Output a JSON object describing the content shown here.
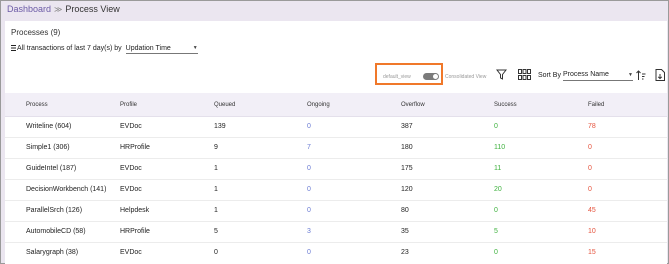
{
  "breadcrumb": {
    "root": "Dashboard",
    "separator": "≫",
    "current": "Process View"
  },
  "processes": {
    "heading": "Processes (9)"
  },
  "filter": {
    "label": "All transactions of last 7 day(s) by",
    "selected": "Updation Time"
  },
  "toolbar": {
    "toggle_left_label": "default_view",
    "toggle_right_label": "Consolidated View",
    "sort_by_label": "Sort By",
    "sort_selected": "Process Name"
  },
  "table": {
    "columns": [
      "Process",
      "Profile",
      "Queued",
      "Ongoing",
      "Overflow",
      "Success",
      "Failed"
    ],
    "rows": [
      {
        "process": "Writeline (604)",
        "profile": "EVDoc",
        "queued": "139",
        "ongoing": "0",
        "overflow": "387",
        "success": "0",
        "failed": "78"
      },
      {
        "process": "Simple1 (306)",
        "profile": "HRProfile",
        "queued": "9",
        "ongoing": "7",
        "overflow": "180",
        "success": "110",
        "failed": "0"
      },
      {
        "process": "GuideIntel (187)",
        "profile": "EVDoc",
        "queued": "1",
        "ongoing": "0",
        "overflow": "175",
        "success": "11",
        "failed": "0"
      },
      {
        "process": "DecisionWorkbench (141)",
        "profile": "EVDoc",
        "queued": "1",
        "ongoing": "0",
        "overflow": "120",
        "success": "20",
        "failed": "0"
      },
      {
        "process": "ParallelSrch (126)",
        "profile": "Helpdesk",
        "queued": "1",
        "ongoing": "0",
        "overflow": "80",
        "success": "0",
        "failed": "45"
      },
      {
        "process": "AutomobileCD (58)",
        "profile": "HRProfile",
        "queued": "5",
        "ongoing": "3",
        "overflow": "35",
        "success": "5",
        "failed": "10"
      },
      {
        "process": "Salarygraph (38)",
        "profile": "EVDoc",
        "queued": "0",
        "ongoing": "0",
        "overflow": "23",
        "success": "0",
        "failed": "15"
      }
    ]
  },
  "colors": {
    "accent": "#6c5ba6",
    "highlight_border": "#f0782a",
    "ongoing": "#6a7bd3",
    "success": "#3fb23f",
    "failed": "#e5533d"
  },
  "icons": [
    "filter-icon",
    "columns-icon",
    "sort-order-icon",
    "export-icon",
    "list-icon"
  ]
}
